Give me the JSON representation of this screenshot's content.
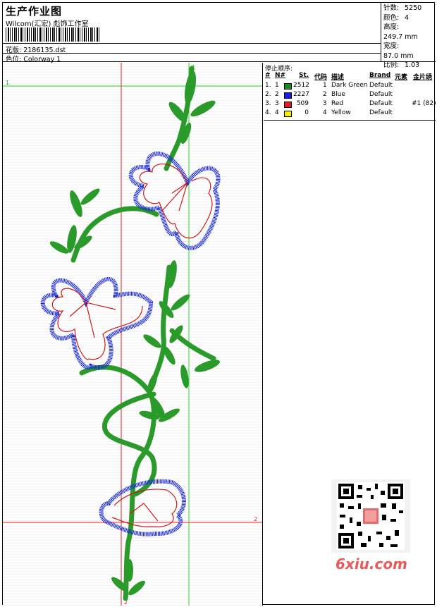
{
  "header": {
    "title": "生产作业图",
    "subtitle": "Wilcom(汇宏) 彪饰工作室",
    "design_line": "花版: 2186135.dst",
    "colorway_line": "色位: Colorway 1"
  },
  "stats": {
    "stitches_label": "针数:",
    "stitches": "5250",
    "colors_label": "颜色:",
    "colors": "4",
    "height_label": "高度:",
    "height": "249.7 mm",
    "width_label": "宽度:",
    "width": "87.0 mm",
    "scale_label": "比例:",
    "scale": "1.03"
  },
  "stop_sequence": {
    "title": "停止顺序:",
    "headers": {
      "hash": "#",
      "num": "N#",
      "st": "St.",
      "code": "代码",
      "desc": "描述",
      "brand": "Brand",
      "elem": "元素",
      "seq": "金片绣"
    },
    "rows": [
      {
        "idx": "1.",
        "n": "1",
        "color": "#1a8a1a",
        "st": "2512",
        "code": "1",
        "desc": "Dark Green",
        "brand": "Default",
        "extra": ""
      },
      {
        "idx": "2.",
        "n": "2",
        "color": "#1a1ae6",
        "st": "2227",
        "code": "2",
        "desc": "Blue",
        "brand": "Default",
        "extra": ""
      },
      {
        "idx": "3.",
        "n": "3",
        "color": "#e61a1a",
        "st": "509",
        "code": "3",
        "desc": "Red",
        "brand": "Default",
        "extra": "#1 (82)"
      },
      {
        "idx": "4.",
        "n": "4",
        "color": "#f0f000",
        "st": "0",
        "code": "4",
        "desc": "Yellow",
        "brand": "Default",
        "extra": ""
      }
    ]
  },
  "guides": {
    "label_1": "1",
    "label_2": "2"
  },
  "watermark": "6xiu.com",
  "colors": {
    "green": "#2a9a2a",
    "blue": "#1a2ad8",
    "red": "#d01818",
    "guide_green": "#22dd22",
    "guide_red": "#dd2222"
  }
}
